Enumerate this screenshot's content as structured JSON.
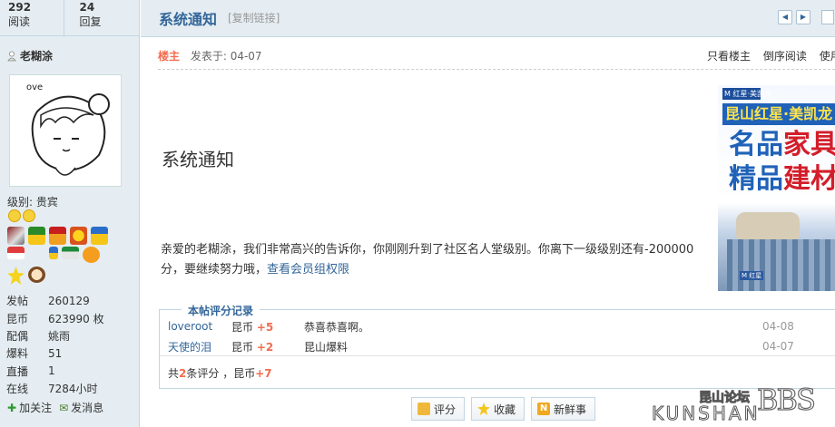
{
  "sidebar": {
    "stats": [
      {
        "num": "292",
        "label": "阅读"
      },
      {
        "num": "24",
        "label": "回复"
      }
    ],
    "author": "老糊涂",
    "level_label": "级别: 贵宾",
    "profile": [
      {
        "key": "发帖",
        "value": "260129"
      },
      {
        "key": "昆币",
        "value": "623990 枚"
      },
      {
        "key": "配偶",
        "value": "姚雨"
      },
      {
        "key": "爆料",
        "value": "51"
      },
      {
        "key": "直播",
        "value": "1"
      },
      {
        "key": "在线",
        "value": "7284小时"
      }
    ],
    "actions": {
      "follow": "加关注",
      "message": "发消息"
    },
    "avatar_text": "ove"
  },
  "header": {
    "title": "系统通知",
    "copy_link": "[复制链接]"
  },
  "post": {
    "author_badge": "楼主",
    "posted_on": "发表于: 04-07",
    "links": [
      "只看楼主",
      "倒序阅读",
      "使用"
    ],
    "heading": "系统通知",
    "message": "亲爱的老糊涂，我们非常高兴的告诉你，你刚刚升到了社区名人堂级别。你离下一级级别还有-200000分，要继续努力哦，",
    "message_link": "查看会员组权限"
  },
  "ad": {
    "logo": "M 红星·美凯龙",
    "band": "昆山红星·美凯龙",
    "line1_a": "名品",
    "line1_b": "家具",
    "line2_a": "精品",
    "line2_b": "建材",
    "tag": "M 红星"
  },
  "ratings": {
    "legend": "本帖评分记录",
    "rows": [
      {
        "user": "loveroot",
        "currency": "昆币",
        "amount": "+5",
        "reason": "恭喜恭喜啊。",
        "date": "04-08"
      },
      {
        "user": "天使的泪",
        "currency": "昆币",
        "amount": "+2",
        "reason": "昆山爆料",
        "date": "04-07"
      }
    ],
    "total_prefix": "共",
    "total_count": "2",
    "total_mid": "条评分 ，昆币",
    "total_amount": "+7"
  },
  "buttons": {
    "rate": "评分",
    "favorite": "收藏",
    "fresh": "新鲜事"
  },
  "watermark": {
    "cn": "昆山论坛",
    "bbs": "BBS",
    "en": "KUNSHAN"
  },
  "colors": {
    "link": "#336699",
    "accent": "#f26c4f",
    "sidebar_bg": "#e5edf2"
  }
}
